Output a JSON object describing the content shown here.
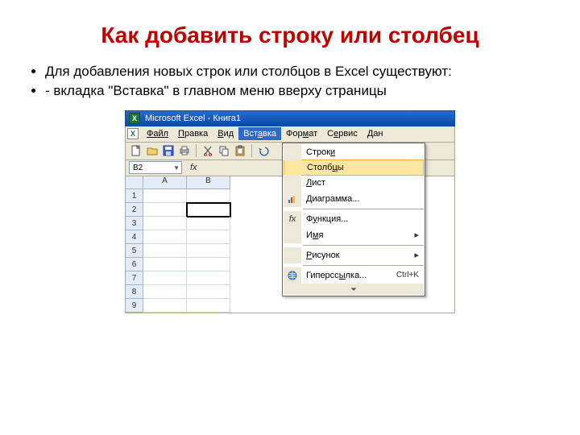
{
  "slide": {
    "title": "Как добавить строку или столбец",
    "bullets": [
      "Для добавления новых строк или столбцов в Excel существуют:",
      "- вкладка \"Вставка\" в главном меню вверху страницы"
    ]
  },
  "excel": {
    "titlebar": "Microsoft Excel - Книга1",
    "menu": {
      "file": "Файл",
      "edit": "Правка",
      "view": "Вид",
      "insert": "Вставка",
      "format": "Формат",
      "tools": "Сервис",
      "data": "Дан"
    },
    "namebox": "B2",
    "fx_label": "fx",
    "columns": [
      "A",
      "B"
    ],
    "rows": [
      "1",
      "2",
      "3",
      "4",
      "5",
      "6",
      "7",
      "8",
      "9"
    ],
    "selected_cell": "B2",
    "dropdown": {
      "rows": "Строки",
      "cols": "Столбцы",
      "sheet": "Лист",
      "chart": "Диаграмма...",
      "function": "Функция...",
      "name": "Имя",
      "picture": "Рисунок",
      "hyperlink": "Гиперссылка...",
      "hyperlink_shortcut": "Ctrl+K"
    }
  }
}
